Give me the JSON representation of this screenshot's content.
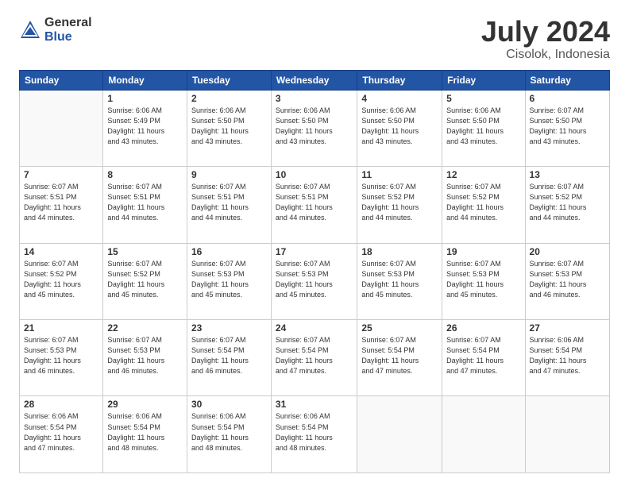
{
  "logo": {
    "general": "General",
    "blue": "Blue"
  },
  "title": "July 2024",
  "subtitle": "Cisolok, Indonesia",
  "days_header": [
    "Sunday",
    "Monday",
    "Tuesday",
    "Wednesday",
    "Thursday",
    "Friday",
    "Saturday"
  ],
  "weeks": [
    [
      {
        "day": "",
        "info": ""
      },
      {
        "day": "1",
        "info": "Sunrise: 6:06 AM\nSunset: 5:49 PM\nDaylight: 11 hours\nand 43 minutes."
      },
      {
        "day": "2",
        "info": "Sunrise: 6:06 AM\nSunset: 5:50 PM\nDaylight: 11 hours\nand 43 minutes."
      },
      {
        "day": "3",
        "info": "Sunrise: 6:06 AM\nSunset: 5:50 PM\nDaylight: 11 hours\nand 43 minutes."
      },
      {
        "day": "4",
        "info": "Sunrise: 6:06 AM\nSunset: 5:50 PM\nDaylight: 11 hours\nand 43 minutes."
      },
      {
        "day": "5",
        "info": "Sunrise: 6:06 AM\nSunset: 5:50 PM\nDaylight: 11 hours\nand 43 minutes."
      },
      {
        "day": "6",
        "info": "Sunrise: 6:07 AM\nSunset: 5:50 PM\nDaylight: 11 hours\nand 43 minutes."
      }
    ],
    [
      {
        "day": "7",
        "info": "Sunrise: 6:07 AM\nSunset: 5:51 PM\nDaylight: 11 hours\nand 44 minutes."
      },
      {
        "day": "8",
        "info": "Sunrise: 6:07 AM\nSunset: 5:51 PM\nDaylight: 11 hours\nand 44 minutes."
      },
      {
        "day": "9",
        "info": "Sunrise: 6:07 AM\nSunset: 5:51 PM\nDaylight: 11 hours\nand 44 minutes."
      },
      {
        "day": "10",
        "info": "Sunrise: 6:07 AM\nSunset: 5:51 PM\nDaylight: 11 hours\nand 44 minutes."
      },
      {
        "day": "11",
        "info": "Sunrise: 6:07 AM\nSunset: 5:52 PM\nDaylight: 11 hours\nand 44 minutes."
      },
      {
        "day": "12",
        "info": "Sunrise: 6:07 AM\nSunset: 5:52 PM\nDaylight: 11 hours\nand 44 minutes."
      },
      {
        "day": "13",
        "info": "Sunrise: 6:07 AM\nSunset: 5:52 PM\nDaylight: 11 hours\nand 44 minutes."
      }
    ],
    [
      {
        "day": "14",
        "info": "Sunrise: 6:07 AM\nSunset: 5:52 PM\nDaylight: 11 hours\nand 45 minutes."
      },
      {
        "day": "15",
        "info": "Sunrise: 6:07 AM\nSunset: 5:52 PM\nDaylight: 11 hours\nand 45 minutes."
      },
      {
        "day": "16",
        "info": "Sunrise: 6:07 AM\nSunset: 5:53 PM\nDaylight: 11 hours\nand 45 minutes."
      },
      {
        "day": "17",
        "info": "Sunrise: 6:07 AM\nSunset: 5:53 PM\nDaylight: 11 hours\nand 45 minutes."
      },
      {
        "day": "18",
        "info": "Sunrise: 6:07 AM\nSunset: 5:53 PM\nDaylight: 11 hours\nand 45 minutes."
      },
      {
        "day": "19",
        "info": "Sunrise: 6:07 AM\nSunset: 5:53 PM\nDaylight: 11 hours\nand 45 minutes."
      },
      {
        "day": "20",
        "info": "Sunrise: 6:07 AM\nSunset: 5:53 PM\nDaylight: 11 hours\nand 46 minutes."
      }
    ],
    [
      {
        "day": "21",
        "info": "Sunrise: 6:07 AM\nSunset: 5:53 PM\nDaylight: 11 hours\nand 46 minutes."
      },
      {
        "day": "22",
        "info": "Sunrise: 6:07 AM\nSunset: 5:53 PM\nDaylight: 11 hours\nand 46 minutes."
      },
      {
        "day": "23",
        "info": "Sunrise: 6:07 AM\nSunset: 5:54 PM\nDaylight: 11 hours\nand 46 minutes."
      },
      {
        "day": "24",
        "info": "Sunrise: 6:07 AM\nSunset: 5:54 PM\nDaylight: 11 hours\nand 47 minutes."
      },
      {
        "day": "25",
        "info": "Sunrise: 6:07 AM\nSunset: 5:54 PM\nDaylight: 11 hours\nand 47 minutes."
      },
      {
        "day": "26",
        "info": "Sunrise: 6:07 AM\nSunset: 5:54 PM\nDaylight: 11 hours\nand 47 minutes."
      },
      {
        "day": "27",
        "info": "Sunrise: 6:06 AM\nSunset: 5:54 PM\nDaylight: 11 hours\nand 47 minutes."
      }
    ],
    [
      {
        "day": "28",
        "info": "Sunrise: 6:06 AM\nSunset: 5:54 PM\nDaylight: 11 hours\nand 47 minutes."
      },
      {
        "day": "29",
        "info": "Sunrise: 6:06 AM\nSunset: 5:54 PM\nDaylight: 11 hours\nand 48 minutes."
      },
      {
        "day": "30",
        "info": "Sunrise: 6:06 AM\nSunset: 5:54 PM\nDaylight: 11 hours\nand 48 minutes."
      },
      {
        "day": "31",
        "info": "Sunrise: 6:06 AM\nSunset: 5:54 PM\nDaylight: 11 hours\nand 48 minutes."
      },
      {
        "day": "",
        "info": ""
      },
      {
        "day": "",
        "info": ""
      },
      {
        "day": "",
        "info": ""
      }
    ]
  ]
}
